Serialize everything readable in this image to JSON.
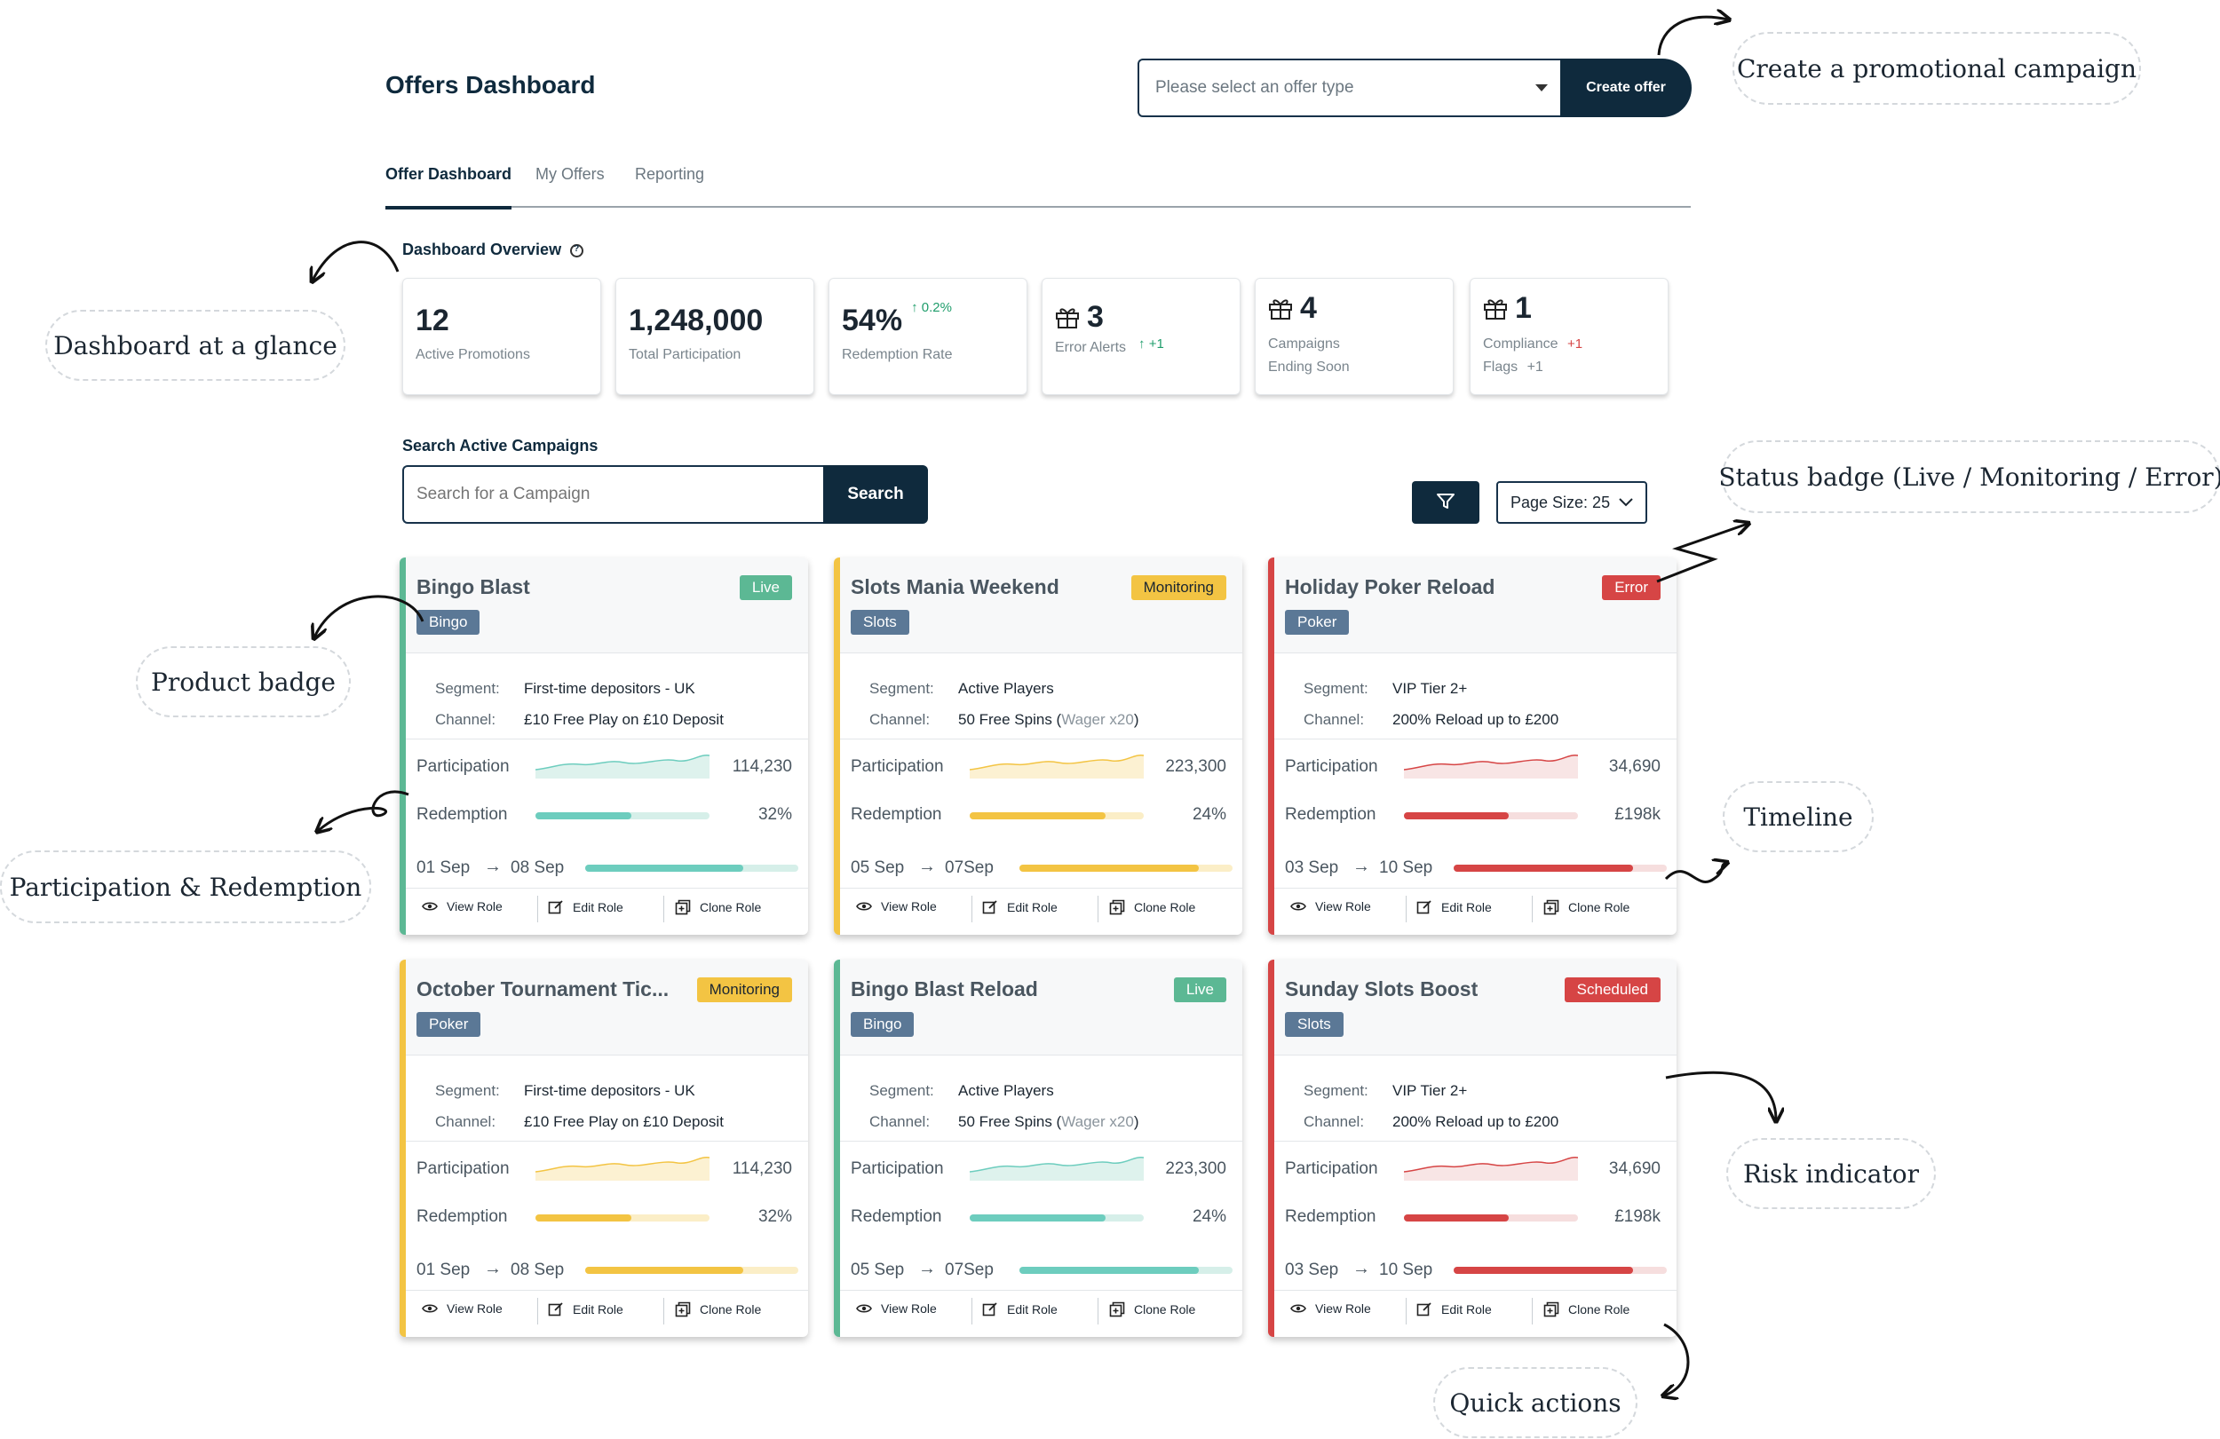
{
  "header": {
    "title": "Offers Dashboard",
    "select_placeholder": "Please select an offer type",
    "create_label": "Create offer"
  },
  "tabs": [
    {
      "label": "Offer Dashboard",
      "active": true
    },
    {
      "label": "My Offers",
      "active": false
    },
    {
      "label": "Reporting",
      "active": false
    }
  ],
  "overview": {
    "title": "Dashboard Overview",
    "stats": [
      {
        "value": "12",
        "label": "Active Promotions"
      },
      {
        "value": "1,248,000",
        "label": "Total Participation"
      },
      {
        "value": "54%",
        "label": "Redemption Rate",
        "trend": "0.2%"
      },
      {
        "value": "3",
        "label": "Error Alerts",
        "trend": "+1",
        "icon": "gift-icon"
      },
      {
        "value": "4",
        "label_line1": "Campaigns",
        "label_line2": "Ending Soon",
        "icon": "gift-icon"
      },
      {
        "value": "1",
        "label_line1": "Compliance",
        "label_line2": "Flags",
        "trend1": "+1",
        "trend2": "+1",
        "icon": "gift-icon"
      }
    ]
  },
  "search": {
    "title": "Search Active Campaigns",
    "placeholder": "Search for a Campaign",
    "button_label": "Search",
    "filter_icon": "filter-icon",
    "page_size_label": "Page Size: 25"
  },
  "labels": {
    "segment": "Segment:",
    "channel": "Channel:",
    "participation": "Participation",
    "redemption": "Redemption",
    "view": "View Role",
    "edit": "Edit Role",
    "clone": "Clone Role"
  },
  "colors": {
    "navy": "#0f2a3d",
    "live": "#5cb894",
    "monitoring": "#f3c443",
    "error": "#d64545",
    "teal": "#6dcdbe",
    "product_badge": "#5b7896"
  },
  "campaigns": [
    {
      "title": "Bingo Blast",
      "status": "Live",
      "product": "Bingo",
      "segment": "First-time depositors - UK",
      "channel": "£10 Free Play on £10 Deposit",
      "participation": "114,230",
      "redemption_value": "32%",
      "redemption_fill": 0.55,
      "start": "01 Sep",
      "end": "08 Sep",
      "timeline_fill": 0.74
    },
    {
      "title": "Slots Mania Weekend",
      "status": "Monitoring",
      "product": "Slots",
      "segment": "Active Players",
      "channel_main": "50 Free Spins (",
      "channel_muted": "Wager x20",
      "channel_close": ")",
      "participation": "223,300",
      "redemption_value": "24%",
      "redemption_fill": 0.78,
      "start": "05 Sep",
      "end": "07Sep",
      "timeline_fill": 0.84
    },
    {
      "title": "Holiday Poker Reload",
      "status": "Error",
      "product": "Poker",
      "segment": "VIP Tier 2+",
      "channel": "200% Reload up to £200",
      "participation": "34,690",
      "redemption_value": "£198k",
      "redemption_fill": 0.6,
      "start": "03 Sep",
      "end": "10 Sep",
      "timeline_fill": 0.84
    },
    {
      "title": "October Tournament Tic...",
      "status": "Monitoring",
      "product": "Poker",
      "segment": "First-time depositors - UK",
      "channel": "£10 Free Play on £10 Deposit",
      "participation": "114,230",
      "redemption_value": "32%",
      "redemption_fill": 0.55,
      "start": "01 Sep",
      "end": "08 Sep",
      "timeline_fill": 0.74
    },
    {
      "title": "Bingo Blast Reload",
      "status": "Live",
      "product": "Bingo",
      "segment": "Active Players",
      "channel_main": "50 Free Spins (",
      "channel_muted": "Wager x20",
      "channel_close": ")",
      "participation": "223,300",
      "redemption_value": "24%",
      "redemption_fill": 0.78,
      "start": "05 Sep",
      "end": "07Sep",
      "timeline_fill": 0.84
    },
    {
      "title": "Sunday Slots Boost",
      "status": "Scheduled",
      "product": "Slots",
      "segment": "VIP Tier 2+",
      "channel": "200% Reload up to £200",
      "participation": "34,690",
      "redemption_value": "£198k",
      "redemption_fill": 0.6,
      "start": "03 Sep",
      "end": "10 Sep",
      "timeline_fill": 0.84
    }
  ],
  "annotations": {
    "create": "Create a promotional campaign",
    "glance": "Dashboard at a glance",
    "status": "Status badge (Live / Monitoring / Error)",
    "product": "Product badge",
    "participation": "Participation & Redemption",
    "timeline": "Timeline",
    "risk": "Risk indicator",
    "quick": "Quick actions"
  }
}
